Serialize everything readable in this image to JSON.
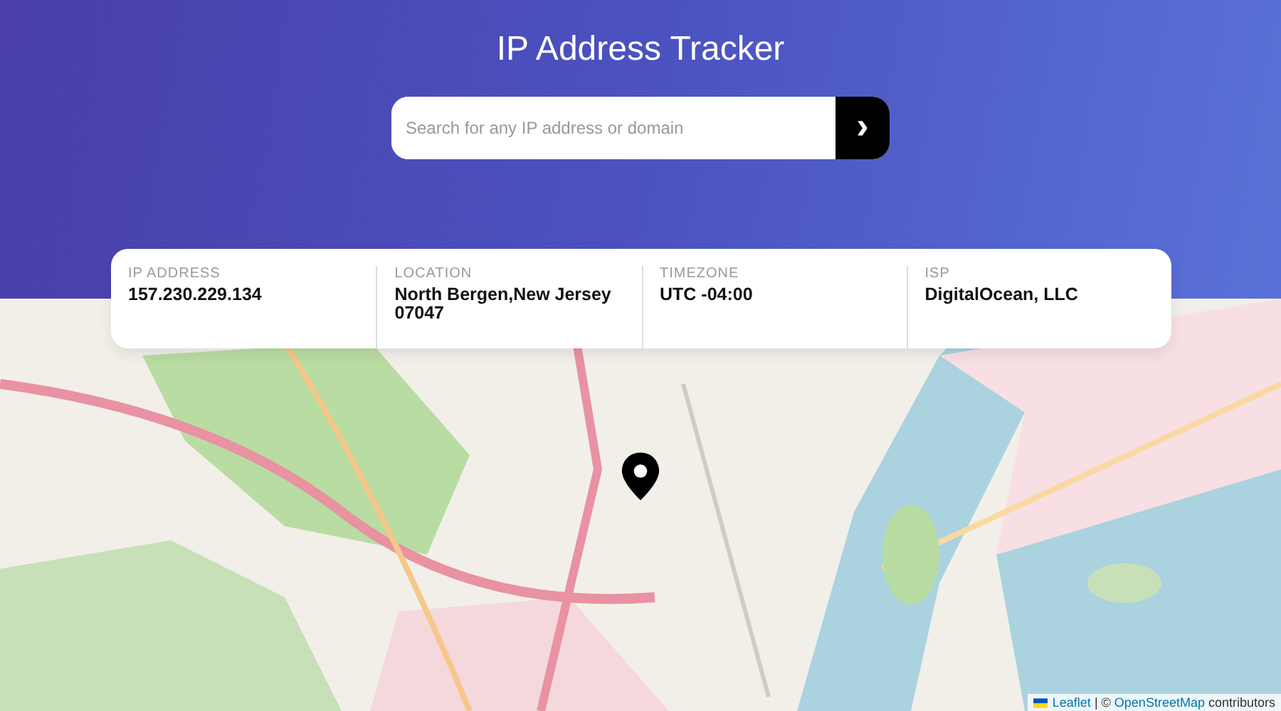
{
  "header": {
    "title": "IP Address Tracker"
  },
  "search": {
    "placeholder": "Search for any IP address or domain",
    "button": "›"
  },
  "info": [
    {
      "label": "IP ADDRESS",
      "value": "157.230.229.134"
    },
    {
      "label": "LOCATION",
      "value": "North Bergen,New Jersey 07047"
    },
    {
      "label": "TIMEZONE",
      "value": "UTC -04:00"
    },
    {
      "label": "ISP",
      "value": "DigitalOcean, LLC"
    }
  ],
  "map": {
    "attribution": {
      "leaflet_link": "Leaflet",
      "separator": "|",
      "copyright": "©",
      "osm_link": "OpenStreetMap",
      "suffix": "contributors"
    }
  }
}
